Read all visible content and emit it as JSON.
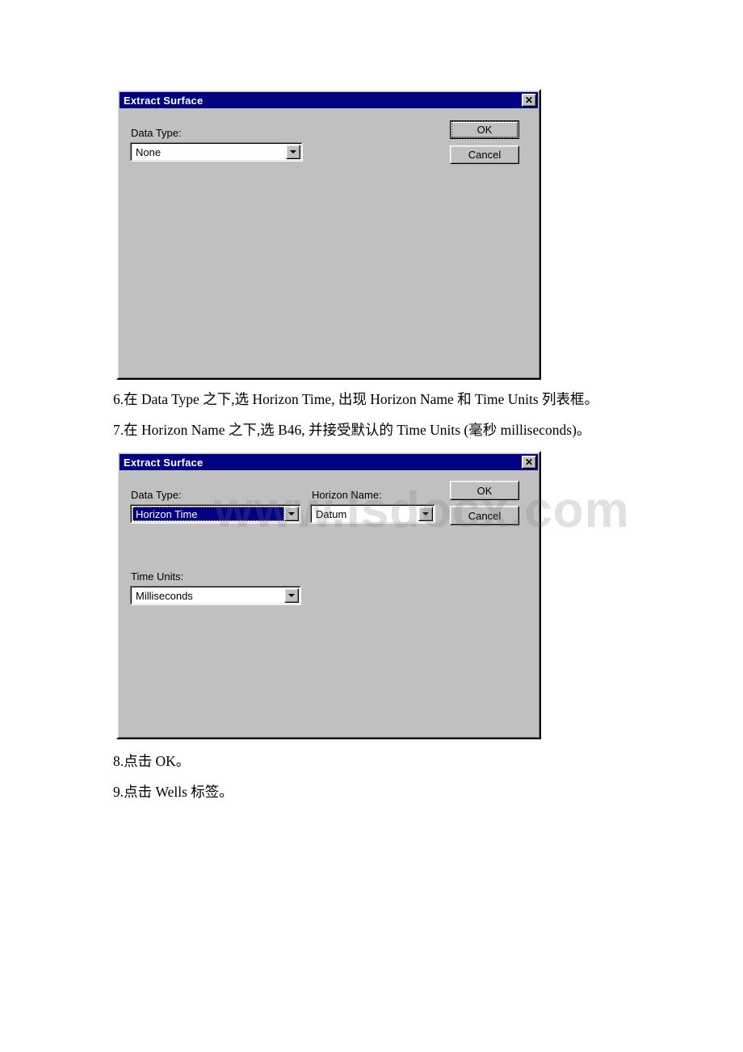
{
  "page": {
    "watermark": "www.lsdocx.com",
    "background": "#ffffff"
  },
  "colors": {
    "titlebar": "#000080",
    "dialog_face": "#c0c0c0",
    "selection": "#000080",
    "field_bg": "#ffffff"
  },
  "dialog1": {
    "title": "Extract Surface",
    "close_glyph": "✕",
    "data_type_label": "Data Type:",
    "data_type_value": "None",
    "ok_label": "OK",
    "cancel_label": "Cancel"
  },
  "dialog2": {
    "title": "Extract Surface",
    "close_glyph": "✕",
    "data_type_label": "Data Type:",
    "data_type_value": "Horizon Time",
    "horizon_name_label": "Horizon Name:",
    "horizon_name_value": "Datum",
    "time_units_label": "Time Units:",
    "time_units_value": "Milliseconds",
    "ok_label": "OK",
    "cancel_label": "Cancel"
  },
  "steps": {
    "step6": "6.在 Data Type 之下,选 Horizon Time, 出现 Horizon Name 和 Time Units 列表框。",
    "step7": "7.在 Horizon Name 之下,选 B46, 并接受默认的 Time Units (毫秒 milliseconds)。",
    "step8": "8.点击 OK。",
    "step9": "9.点击 Wells 标签。"
  }
}
